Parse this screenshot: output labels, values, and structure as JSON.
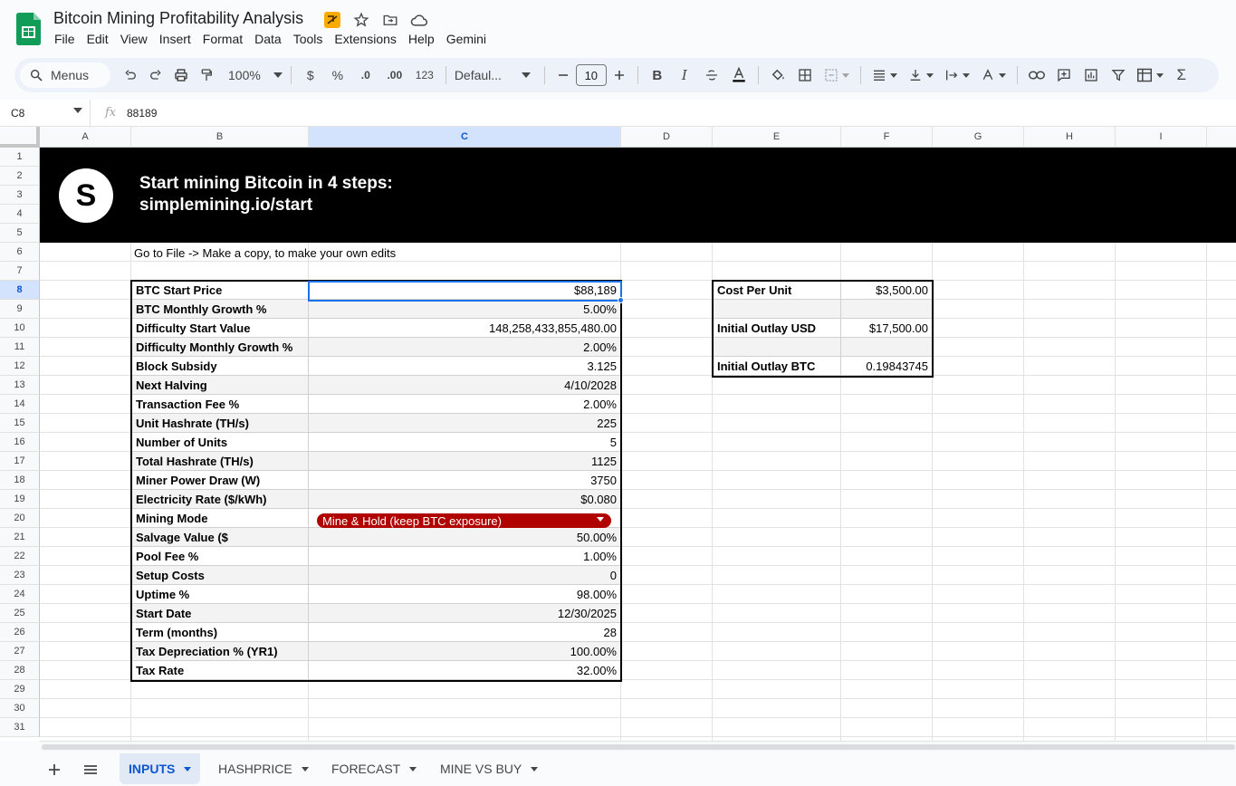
{
  "app": {
    "title": "Bitcoin Mining Profitability Analysis",
    "menus": [
      "File",
      "Edit",
      "View",
      "Insert",
      "Format",
      "Data",
      "Tools",
      "Extensions",
      "Help",
      "Gemini"
    ],
    "brand_color": "#0f9d58",
    "title_icons": [
      "cloud-sync-warning-icon",
      "star-icon",
      "move-to-folder-icon",
      "cloud-status-icon"
    ]
  },
  "toolbar": {
    "search_label": "Menus",
    "zoom": "100%",
    "currency": "$",
    "percent": "%",
    "decrease_decimal": ".0",
    "increase_decimal": ".00",
    "number_format": "123",
    "font": "Defaul...",
    "font_size": "10"
  },
  "formula_bar": {
    "cell_ref": "C8",
    "fx": "fx",
    "value": "88189"
  },
  "columns": [
    "A",
    "B",
    "C",
    "D",
    "E",
    "F",
    "G",
    "H",
    "I"
  ],
  "rows": [
    "1",
    "2",
    "3",
    "4",
    "5",
    "6",
    "7",
    "8",
    "9",
    "10",
    "11",
    "12",
    "13",
    "14",
    "15",
    "16",
    "17",
    "18",
    "19",
    "20",
    "21",
    "22",
    "23",
    "24",
    "25",
    "26",
    "27",
    "28",
    "29",
    "30",
    "31"
  ],
  "banner": {
    "logo_letter": "S",
    "line1": "Start mining Bitcoin in 4 steps:",
    "line2": "simplemining.io/start"
  },
  "note": "Go to File -> Make a copy, to make your own edits",
  "inputs": [
    {
      "label": "BTC Start Price",
      "value": "$88,189"
    },
    {
      "label": "BTC Monthly Growth %",
      "value": "5.00%"
    },
    {
      "label": "Difficulty Start Value",
      "value": "148,258,433,855,480.00"
    },
    {
      "label": "Difficulty Monthly Growth %",
      "value": "2.00%"
    },
    {
      "label": "Block Subsidy",
      "value": "3.125"
    },
    {
      "label": "Next Halving",
      "value": "4/10/2028"
    },
    {
      "label": "Transaction Fee %",
      "value": "2.00%"
    },
    {
      "label": "Unit Hashrate (TH/s)",
      "value": "225"
    },
    {
      "label": "Number of Units",
      "value": "5"
    },
    {
      "label": "Total Hashrate (TH/s)",
      "value": "1125"
    },
    {
      "label": "Miner Power Draw (W)",
      "value": "3750"
    },
    {
      "label": "Electricity Rate ($/kWh)",
      "value": "$0.080"
    },
    {
      "label": "Mining Mode",
      "value": "Mine & Hold (keep BTC exposure)"
    },
    {
      "label": "Salvage Value ($",
      "value": "50.00%"
    },
    {
      "label": "Pool Fee %",
      "value": "1.00%"
    },
    {
      "label": "Setup Costs",
      "value": "0"
    },
    {
      "label": "Uptime %",
      "value": "98.00%"
    },
    {
      "label": "Start Date",
      "value": "12/30/2025"
    },
    {
      "label": "Term (months)",
      "value": "28"
    },
    {
      "label": "Tax Depreciation % (YR1)",
      "value": "100.00%"
    },
    {
      "label": "Tax Rate",
      "value": "32.00%"
    }
  ],
  "mining_mode_chip_color": "#b10202",
  "cost_table": [
    {
      "label": "Cost Per Unit",
      "value": "$3,500.00"
    },
    {
      "label": "",
      "value": ""
    },
    {
      "label": "Initial Outlay USD",
      "value": "$17,500.00"
    },
    {
      "label": "",
      "value": ""
    },
    {
      "label": "Initial Outlay BTC",
      "value": "0.19843745"
    }
  ],
  "sheet_tabs": [
    {
      "label": "INPUTS",
      "active": true
    },
    {
      "label": "HASHPRICE",
      "active": false
    },
    {
      "label": "FORECAST",
      "active": false
    },
    {
      "label": "MINE VS BUY",
      "active": false
    }
  ],
  "selection_color": "#1a73e8"
}
